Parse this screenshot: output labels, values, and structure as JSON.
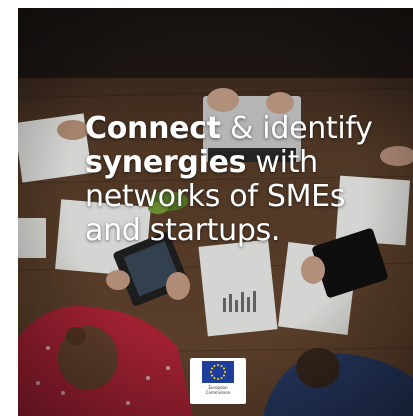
{
  "headline": {
    "line1_strong": "Connect",
    "line1_rest": " & identify",
    "line2_strong": "synergies",
    "line2_rest": " with",
    "line3": "networks of SMEs",
    "line4": "and startups."
  },
  "logo": {
    "text_line1": "European",
    "text_line2": "Commission"
  },
  "colors": {
    "headline_text": "#ffffff",
    "table_wood": "#5a3e2a",
    "eu_blue": "#1f3e9c",
    "eu_star": "#ffdd00"
  }
}
